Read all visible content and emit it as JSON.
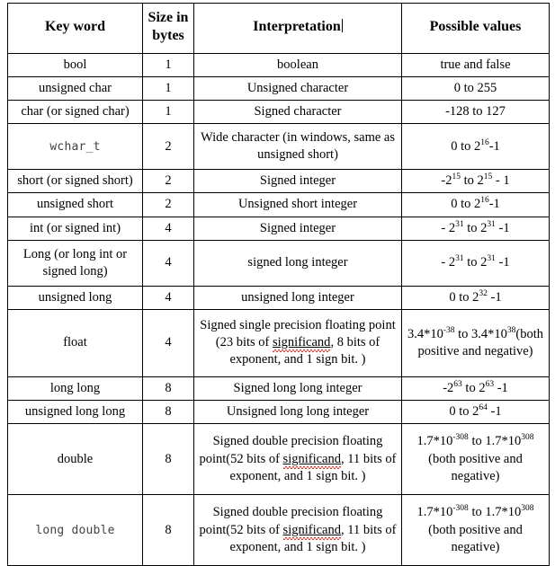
{
  "document": {
    "kind": "data-type-reference-table",
    "spellcheck_word": "significand",
    "caret_after_header": "Interpretation"
  },
  "table": {
    "headers": [
      "Key word",
      "Size in bytes",
      "Interpretation",
      "Possible values"
    ],
    "header_lines": {
      "key_word": "Key word",
      "size_in": "Size in",
      "bytes": "bytes",
      "interpretation": "Interpretation",
      "possible_values": "Possible values"
    },
    "rows": [
      {
        "keyword": "bool",
        "keyword_style": "serif",
        "size": "1",
        "interpretation": "boolean",
        "values": "true  and false"
      },
      {
        "keyword": "unsigned char",
        "keyword_style": "serif",
        "size": "1",
        "interpretation": "Unsigned character",
        "values": "0 to 255"
      },
      {
        "keyword": "char (or signed char)",
        "keyword_style": "serif",
        "size": "1",
        "interpretation": "Signed character",
        "values": "-128 to 127"
      },
      {
        "keyword": "wchar_t",
        "keyword_style": "mono",
        "size": "2",
        "interpretation": "Wide character (in windows, same as unsigned short)",
        "values_prefix": "0 to 2",
        "values_sup": "16",
        "values_suffix": "-1"
      },
      {
        "keyword": "short (or signed short)",
        "keyword_style": "serif",
        "size": "2",
        "interpretation": "Signed integer",
        "values_a_prefix": "-2",
        "values_a_sup": "15",
        "values_mid": " to 2",
        "values_b_sup": "15",
        "values_suffix": " - 1"
      },
      {
        "keyword": "unsigned short",
        "keyword_style": "serif",
        "size": "2",
        "interpretation": "Unsigned short integer",
        "values_prefix": "0 to 2",
        "values_sup": "16",
        "values_suffix": "-1"
      },
      {
        "keyword": "int (or signed int)",
        "keyword_style": "serif",
        "size": "4",
        "interpretation": "Signed integer",
        "values_a_prefix": "- 2",
        "values_a_sup": "31",
        "values_mid": " to  2",
        "values_b_sup": "31",
        "values_suffix": " -1"
      },
      {
        "keyword": "Long (or long int or signed long)",
        "keyword_style": "serif",
        "size": "4",
        "interpretation": "signed long integer",
        "values_a_prefix": "- 2",
        "values_a_sup": "31",
        "values_mid": " to  2",
        "values_b_sup": "31",
        "values_suffix": " -1"
      },
      {
        "keyword": "unsigned long",
        "keyword_style": "serif",
        "size": "4",
        "interpretation": "unsigned long integer",
        "values_prefix": "0 to 2",
        "values_sup": "32",
        "values_suffix": " -1"
      },
      {
        "keyword": "float",
        "keyword_style": "serif",
        "size": "4",
        "interp_part1": "Signed single precision floating point (23 bits of ",
        "interp_spell": "significand",
        "interp_part2": ", 8 bits of exponent, and 1 sign bit. )",
        "values_a_prefix": "3.4*10",
        "values_a_sup": "-38",
        "values_mid": " to 3.4*10",
        "values_b_sup": "38",
        "values_suffix": "(both positive and negative)"
      },
      {
        "keyword": "long long",
        "keyword_style": "serif",
        "size": "8",
        "interpretation": "Signed long long integer",
        "values_a_prefix": "-2",
        "values_a_sup": "63",
        "values_mid": " to 2",
        "values_b_sup": "63",
        "values_suffix": " -1"
      },
      {
        "keyword": "unsigned long long",
        "keyword_style": "serif",
        "size": "8",
        "interpretation": "Unsigned long long integer",
        "values_prefix": "0 to 2",
        "values_sup": "64",
        "values_suffix": " -1"
      },
      {
        "keyword": "double",
        "keyword_style": "serif",
        "size": "8",
        "interp_part1": "Signed double precision floating point(52 bits of ",
        "interp_spell": "significand",
        "interp_part2": ", 11 bits of exponent, and 1 sign bit. )",
        "values_a_prefix": "1.7*10",
        "values_a_sup": "-308",
        "values_mid": " to 1.7*10",
        "values_b_sup": "308",
        "values_suffix": "(both positive and negative)"
      },
      {
        "keyword": "long double",
        "keyword_style": "mono",
        "size": "8",
        "interp_part1": "Signed double precision floating point(52 bits of ",
        "interp_spell": "significand",
        "interp_part2": ", 11 bits of exponent, and 1 sign bit. )",
        "values_a_prefix": "1.7*10",
        "values_a_sup": "-308",
        "values_mid": " to 1.7*10",
        "values_b_sup": "308",
        "values_suffix": "(both positive and negative)"
      }
    ]
  }
}
